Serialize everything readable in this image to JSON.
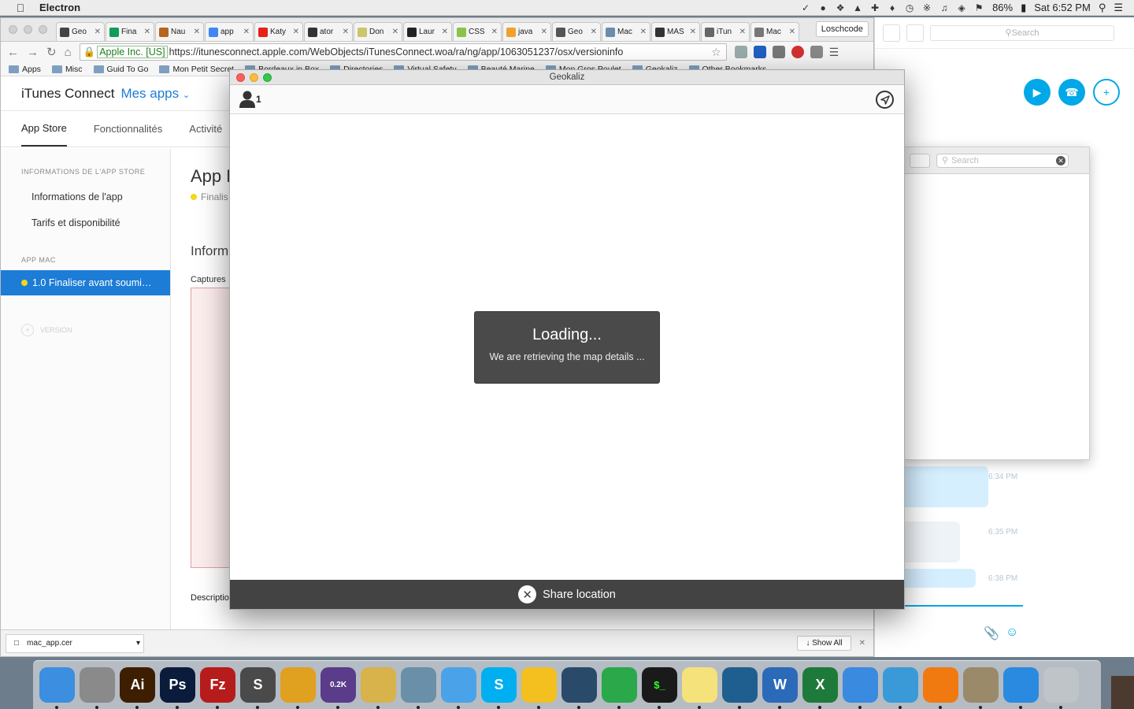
{
  "menubar": {
    "app_name": "Electron",
    "battery": "86%",
    "clock": "Sat 6:52 PM"
  },
  "chrome": {
    "tabs": [
      {
        "label": "Geo",
        "color": "#444444"
      },
      {
        "label": "Fina",
        "color": "#0f9d58"
      },
      {
        "label": "Nau",
        "color": "#b5651d"
      },
      {
        "label": "app",
        "color": "#4285f4"
      },
      {
        "label": "Katy",
        "color": "#e62117"
      },
      {
        "label": "ator",
        "color": "#333333"
      },
      {
        "label": "Don",
        "color": "#c9c66b"
      },
      {
        "label": "Laur",
        "color": "#222222"
      },
      {
        "label": "CSS",
        "color": "#8bc34a"
      },
      {
        "label": "java",
        "color": "#f0a030"
      },
      {
        "label": "Geo",
        "color": "#555555"
      },
      {
        "label": "Mac",
        "color": "#6a8caf"
      },
      {
        "label": "MAS",
        "color": "#333333"
      },
      {
        "label": "iTun",
        "color": "#666666"
      },
      {
        "label": "Mac",
        "color": "#777777"
      }
    ],
    "profile_name": "Loschcode",
    "secure_label": "Apple Inc. [US]",
    "url": "https://itunesconnect.apple.com/WebObjects/iTunesConnect.woa/ra/ng/app/1063051237/osx/versioninfo",
    "bookmarks": [
      "Apps",
      "Misc",
      "Guid To Go",
      "Mon Petit Secret",
      "Bordeaux in Box",
      "Directories",
      "Virtual Safety",
      "Beauté Marine",
      "Mon Gros Poulet",
      "Geokaliz",
      "Other Bookmarks"
    ]
  },
  "itc": {
    "brand": "iTunes Connect",
    "my_apps": "Mes apps",
    "tabs": [
      "App Store",
      "Fonctionnalités",
      "Activité"
    ],
    "side_section_store": "INFORMATIONS DE L'APP STORE",
    "side_items": [
      "Informations de l'app",
      "Tarifs et disponibilité"
    ],
    "side_section_mac": "APP MAC",
    "selected_version": "1.0 Finaliser avant soumi…",
    "add_version": "VERSION",
    "main_title": "App M",
    "main_status": "Finalis",
    "main_section": "Inform",
    "captures_label": "Captures",
    "description_label": "Descriptio"
  },
  "downloads": {
    "file": "mac_app.cer",
    "show_all": "Show All"
  },
  "skype": {
    "search_placeholder": "Search",
    "times": [
      "6:34 PM",
      "6:35 PM",
      "6:38 PM"
    ]
  },
  "finder": {
    "search_placeholder": "Search"
  },
  "geo": {
    "window_title": "Geokaliz",
    "user_count": "1",
    "loading_title": "Loading...",
    "loading_subtitle": "We are retrieving the map details ...",
    "share_label": "Share location"
  },
  "dock": [
    {
      "name": "finder",
      "label": "",
      "color": "#3b8ee0"
    },
    {
      "name": "launchpad",
      "label": "",
      "color": "#8a8a8a"
    },
    {
      "name": "illustrator",
      "label": "Ai",
      "color": "#3d1e00"
    },
    {
      "name": "photoshop",
      "label": "Ps",
      "color": "#0b1b3b"
    },
    {
      "name": "filezilla",
      "label": "Fz",
      "color": "#b71c1c"
    },
    {
      "name": "sublime",
      "label": "S",
      "color": "#4a4a4a"
    },
    {
      "name": "chrome",
      "label": "",
      "color": "#e0a020"
    },
    {
      "name": "network-monitor",
      "label": "0.2K",
      "color": "#5a3c8a"
    },
    {
      "name": "sequel-pro",
      "label": "",
      "color": "#d8b24a"
    },
    {
      "name": "preview",
      "label": "",
      "color": "#6a8fa8"
    },
    {
      "name": "messages-blue",
      "label": "",
      "color": "#4aa3e8"
    },
    {
      "name": "skype",
      "label": "S",
      "color": "#00aff0"
    },
    {
      "name": "mango",
      "label": "",
      "color": "#f3c020"
    },
    {
      "name": "mysql-workbench",
      "label": "",
      "color": "#2a4a6a"
    },
    {
      "name": "mind-node",
      "label": "",
      "color": "#2aa84a"
    },
    {
      "name": "terminal",
      "label": "$_",
      "color": "#1a1a1a"
    },
    {
      "name": "notes",
      "label": "",
      "color": "#f5e27a"
    },
    {
      "name": "sourcetree",
      "label": "",
      "color": "#1f5f8f"
    },
    {
      "name": "word",
      "label": "W",
      "color": "#2a6ab8"
    },
    {
      "name": "excel",
      "label": "X",
      "color": "#1e7a3a"
    },
    {
      "name": "messenger",
      "label": "",
      "color": "#3a8ae0"
    },
    {
      "name": "sequel-elephant",
      "label": "",
      "color": "#3a9ad8"
    },
    {
      "name": "vlc",
      "label": "",
      "color": "#f07a10"
    },
    {
      "name": "keychain",
      "label": "",
      "color": "#9a8a6a"
    },
    {
      "name": "safari",
      "label": "",
      "color": "#2a8ae0"
    },
    {
      "name": "trash",
      "label": "",
      "color": "#bfc4c8"
    }
  ]
}
